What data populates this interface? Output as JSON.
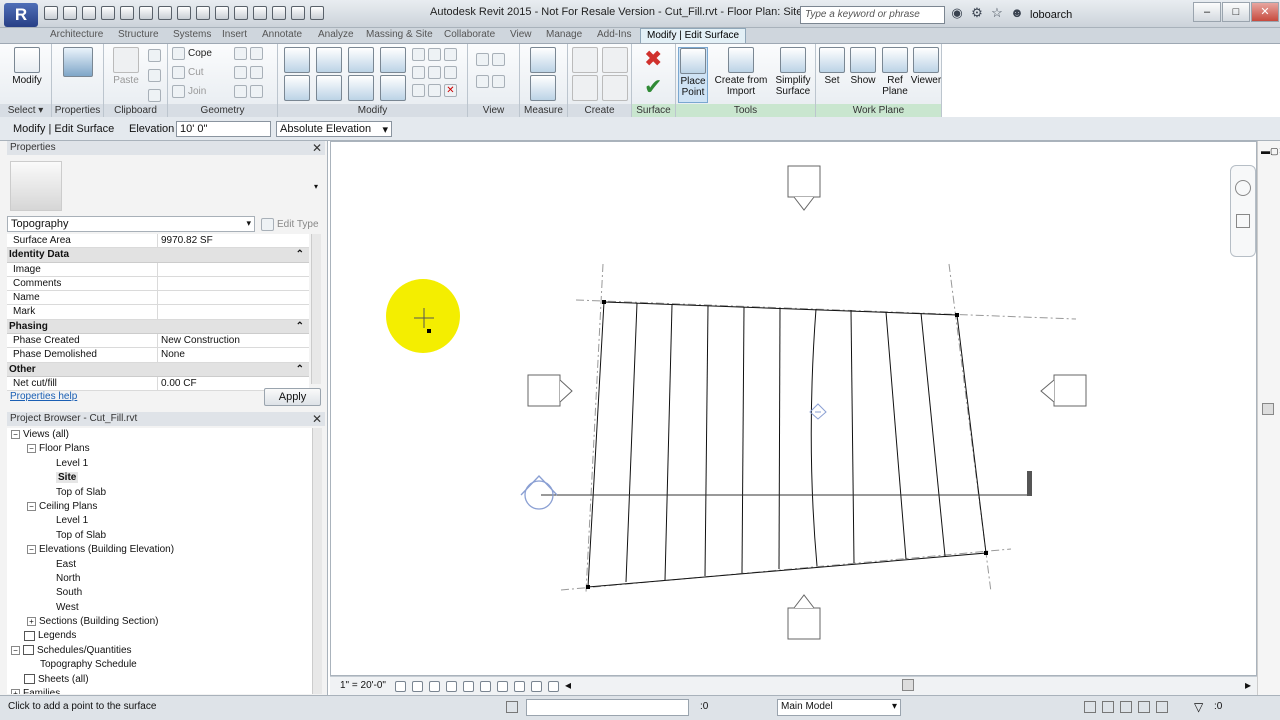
{
  "titlebar": {
    "app_logo": "R",
    "title": "Autodesk Revit 2015 - Not For Resale Version   -   Cut_Fill.rvt - Floor Plan: Site",
    "search_placeholder": "Type a keyword or phrase",
    "user": "loboarch",
    "win_controls": [
      "–",
      "□",
      "✕"
    ]
  },
  "tabs": [
    "Architecture",
    "Structure",
    "Systems",
    "Insert",
    "Annotate",
    "Analyze",
    "Massing & Site",
    "Collaborate",
    "View",
    "Manage",
    "Add-Ins",
    "Modify | Edit Surface"
  ],
  "ribbon": {
    "select": {
      "label": "Select ▾",
      "modify": "Modify"
    },
    "properties": {
      "label": "Properties"
    },
    "clipboard": {
      "label": "Clipboard",
      "paste": "Paste"
    },
    "geometry": {
      "label": "Geometry",
      "cope": "Cope",
      "cut": "Cut",
      "join": "Join"
    },
    "modify_label": "Modify",
    "view_label": "View",
    "measure_label": "Measure",
    "create_label": "Create",
    "surface": {
      "label": "Surface"
    },
    "tools": {
      "label": "Tools",
      "place_point": "Place Point",
      "create_from_import": "Create from Import",
      "simplify_surface": "Simplify Surface"
    },
    "work_plane": {
      "label": "Work Plane",
      "set": "Set",
      "show": "Show",
      "ref_plane": "Ref Plane",
      "viewer": "Viewer"
    }
  },
  "options_bar": {
    "context": "Modify | Edit Surface",
    "elevation_label": "Elevation",
    "elevation_value": "10'  0\"",
    "elevation_mode": "Absolute Elevation"
  },
  "properties_pane": {
    "title": "Properties",
    "type": "Topography",
    "edit_type": "Edit Type",
    "rows": [
      {
        "kind": "row",
        "name": "Surface Area",
        "value": "9970.82 SF"
      },
      {
        "kind": "section",
        "name": "Identity Data"
      },
      {
        "kind": "row",
        "name": "Image",
        "value": ""
      },
      {
        "kind": "row",
        "name": "Comments",
        "value": ""
      },
      {
        "kind": "row",
        "name": "Name",
        "value": ""
      },
      {
        "kind": "row",
        "name": "Mark",
        "value": ""
      },
      {
        "kind": "section",
        "name": "Phasing"
      },
      {
        "kind": "row",
        "name": "Phase Created",
        "value": "New Construction"
      },
      {
        "kind": "row",
        "name": "Phase Demolished",
        "value": "None"
      },
      {
        "kind": "section",
        "name": "Other"
      },
      {
        "kind": "row",
        "name": "Net cut/fill",
        "value": "0.00 CF"
      }
    ],
    "help": "Properties help",
    "apply": "Apply"
  },
  "project_browser": {
    "title": "Project Browser - Cut_Fill.rvt",
    "nodes": [
      {
        "label": "Views (all)",
        "level": 0,
        "exp": "-"
      },
      {
        "label": "Floor Plans",
        "level": 1,
        "exp": "-"
      },
      {
        "label": "Level 1",
        "level": 2,
        "exp": ""
      },
      {
        "label": "Site",
        "level": 2,
        "exp": "",
        "selected": true
      },
      {
        "label": "Top of Slab",
        "level": 2,
        "exp": ""
      },
      {
        "label": "Ceiling Plans",
        "level": 1,
        "exp": "-"
      },
      {
        "label": "Level 1",
        "level": 2,
        "exp": ""
      },
      {
        "label": "Top of Slab",
        "level": 2,
        "exp": ""
      },
      {
        "label": "Elevations (Building Elevation)",
        "level": 1,
        "exp": "-"
      },
      {
        "label": "East",
        "level": 2,
        "exp": ""
      },
      {
        "label": "North",
        "level": 2,
        "exp": ""
      },
      {
        "label": "South",
        "level": 2,
        "exp": ""
      },
      {
        "label": "West",
        "level": 2,
        "exp": ""
      },
      {
        "label": "Sections (Building Section)",
        "level": 1,
        "exp": "+"
      },
      {
        "label": "Legends",
        "level": 0,
        "exp": "",
        "icon": true
      },
      {
        "label": "Schedules/Quantities",
        "level": 0,
        "exp": "-",
        "icon": true
      },
      {
        "label": "Topography Schedule",
        "level": 1,
        "exp": ""
      },
      {
        "label": "Sheets (all)",
        "level": 0,
        "exp": "",
        "icon": true
      },
      {
        "label": "Families",
        "level": 0,
        "exp": "+"
      }
    ]
  },
  "view_control": {
    "scale": "1\" = 20'-0\""
  },
  "statusbar": {
    "message": "Click to add a point to the surface",
    "zero": ":0",
    "model": "Main Model",
    "filter": ":0"
  }
}
